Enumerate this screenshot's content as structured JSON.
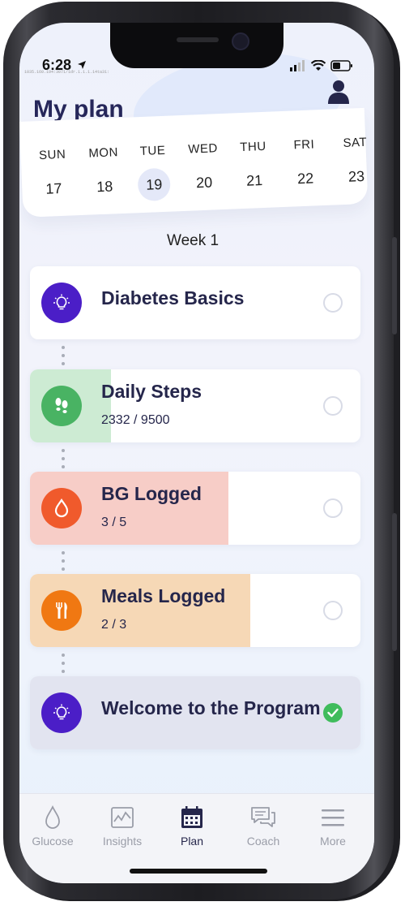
{
  "status_bar": {
    "time": "6:28",
    "url_text": "1035.160.194:3071/1dr.1.1.1.14ta31:"
  },
  "header": {
    "title": "My plan"
  },
  "calendar": {
    "days": [
      {
        "name": "SUN",
        "num": "17"
      },
      {
        "name": "MON",
        "num": "18"
      },
      {
        "name": "TUE",
        "num": "19"
      },
      {
        "name": "WED",
        "num": "20"
      },
      {
        "name": "THU",
        "num": "21"
      },
      {
        "name": "FRI",
        "num": "22"
      },
      {
        "name": "SAT",
        "num": "23"
      }
    ],
    "selected": "19"
  },
  "week": {
    "label": "Week 1"
  },
  "tasks": [
    {
      "title": "Diabetes Basics",
      "subtitle": "",
      "icon": "lightbulb-icon",
      "color": "#4b1ec7",
      "fill_color": "",
      "progress": 0,
      "done": false
    },
    {
      "title": "Daily Steps",
      "subtitle": "2332 / 9500",
      "icon": "footsteps-icon",
      "color": "#49b363",
      "fill_color": "#cdebd3",
      "progress": 0.245,
      "done": false
    },
    {
      "title": "BG Logged",
      "subtitle": "3 / 5",
      "icon": "drop-icon",
      "color": "#f05a2c",
      "fill_color": "#f7cdc7",
      "progress": 0.6,
      "done": false
    },
    {
      "title": "Meals Logged",
      "subtitle": "2 / 3",
      "icon": "fork-knife-icon",
      "color": "#f07812",
      "fill_color": "#f6d8b6",
      "progress": 0.667,
      "done": false
    },
    {
      "title": "Welcome to the Program",
      "subtitle": "",
      "icon": "lightbulb-icon",
      "color": "#4b1ec7",
      "fill_color": "#e2e4f0",
      "progress": 1,
      "done": true
    }
  ],
  "tabs": [
    {
      "label": "Glucose",
      "icon": "drop-outline-icon",
      "active": false
    },
    {
      "label": "Insights",
      "icon": "chart-icon",
      "active": false
    },
    {
      "label": "Plan",
      "icon": "calendar-icon",
      "active": true
    },
    {
      "label": "Coach",
      "icon": "chat-bubbles-icon",
      "active": false
    },
    {
      "label": "More",
      "icon": "menu-icon",
      "active": false
    }
  ],
  "colors": {
    "accent": "#25264b",
    "inactive": "#9a9da8",
    "check_done": "#3fbc5c"
  }
}
